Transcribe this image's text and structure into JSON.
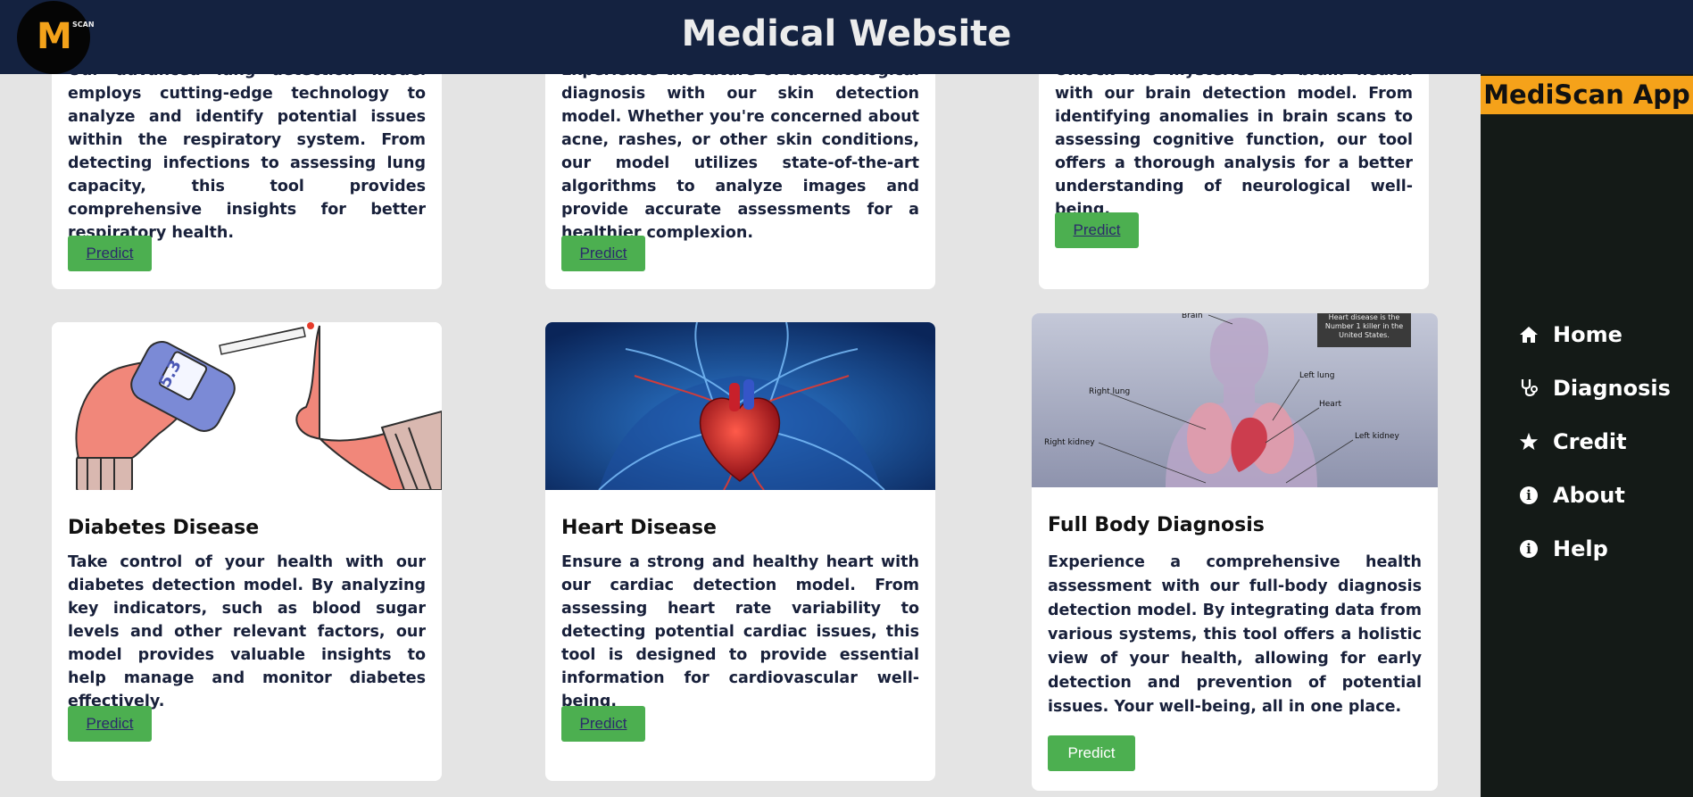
{
  "header": {
    "title": "Medical Website",
    "logo": {
      "letter": "M",
      "side_text": "SCAN"
    }
  },
  "sidebar": {
    "app_name": "MediScan App",
    "items": [
      {
        "label": "Home",
        "icon": "home-icon"
      },
      {
        "label": "Diagnosis",
        "icon": "stethoscope-icon"
      },
      {
        "label": "Credit",
        "icon": "star-icon"
      },
      {
        "label": "About",
        "icon": "info-icon"
      },
      {
        "label": "Help",
        "icon": "info-icon"
      }
    ]
  },
  "cards": [
    {
      "text": "Our advanced lung detection model employs cutting-edge technology to analyze and identify potential issues within the respiratory system. From detecting infections to assessing lung capacity, this tool provides comprehensive insights for better respiratory health.",
      "button": "Predict"
    },
    {
      "text": "Experience the future of dermatological diagnosis with our skin detection model. Whether you're concerned about acne, rashes, or other skin conditions, our model utilizes state-of-the-art algorithms to analyze images and provide accurate assessments for a healthier complexion.",
      "button": "Predict"
    },
    {
      "text": "Unlock the mysteries of brain health with our brain detection model. From identifying anomalies in brain scans to assessing cognitive function, our tool offers a thorough analysis for a better understanding of neurological well-being.",
      "button": "Predict"
    },
    {
      "title": "Diabetes Disease",
      "text": "Take control of your health with our diabetes detection model. By analyzing key indicators, such as blood sugar levels and other relevant factors, our model provides valuable insights to help manage and monitor diabetes effectively.",
      "button": "Predict",
      "image": {
        "reading": "5.3"
      }
    },
    {
      "title": "Heart Disease",
      "text": "Ensure a strong and healthy heart with our cardiac detection model. From assessing heart rate variability to detecting potential cardiac issues, this tool is designed to provide essential information for cardiovascular well-being.",
      "button": "Predict"
    },
    {
      "title": "Full Body Diagnosis",
      "text": "Experience a comprehensive health assessment with our full-body diagnosis detection model. By integrating data from various systems, this tool offers a holistic view of your health, allowing for early detection and prevention of potential issues. Your well-being, all in one place.",
      "button": "Predict",
      "image": {
        "caption": "Heart disease is the Number 1 killer in the United States.",
        "labels": {
          "brain": "Brain",
          "right_lung": "Right lung",
          "left_lung": "Left lung",
          "heart": "Heart",
          "right_kidney": "Right kidney",
          "left_kidney": "Left kidney"
        }
      }
    }
  ],
  "colors": {
    "header_bg": "#142240",
    "sidebar_bg": "#141a17",
    "accent": "#f5a21a",
    "button_bg": "#4caf50",
    "page_bg": "#e4e4e4"
  }
}
